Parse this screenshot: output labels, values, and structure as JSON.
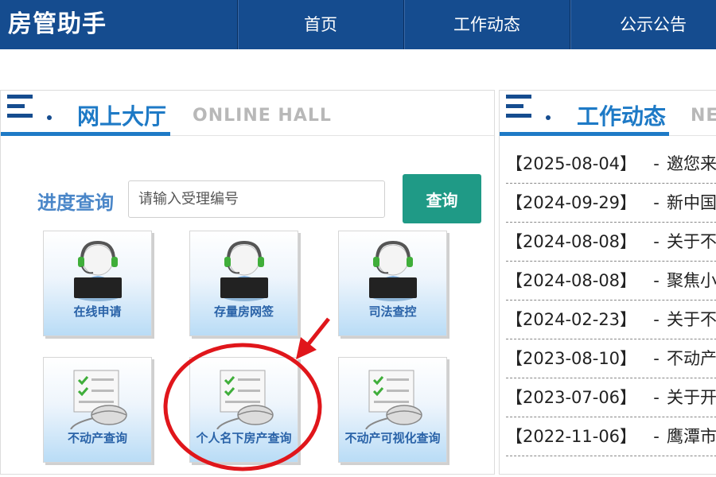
{
  "header": {
    "logo": "房管助手",
    "nav": [
      "首页",
      "工作动态",
      "公示公告"
    ]
  },
  "left_panel": {
    "title": "网上大厅",
    "subtitle": "ONLINE HALL",
    "search": {
      "label": "进度查询",
      "placeholder": "请输入受理编号",
      "button": "查询"
    },
    "tiles": [
      "在线申请",
      "存量房网签",
      "司法查控",
      "不动产查询",
      "个人名下房产查询",
      "不动产可视化查询"
    ]
  },
  "right_panel": {
    "title": "工作动态",
    "subtitle": "NE",
    "news": [
      {
        "date": "【2025-08-04】",
        "dash": "-",
        "title": "邀您来"
      },
      {
        "date": "【2024-09-29】",
        "dash": "-",
        "title": "新中国"
      },
      {
        "date": "【2024-08-08】",
        "dash": "-",
        "title": "关于不"
      },
      {
        "date": "【2024-08-08】",
        "dash": "-",
        "title": "聚焦小"
      },
      {
        "date": "【2024-02-23】",
        "dash": "-",
        "title": "关于不"
      },
      {
        "date": "【2023-08-10】",
        "dash": "-",
        "title": "不动产"
      },
      {
        "date": "【2023-07-06】",
        "dash": "-",
        "title": "关于开"
      },
      {
        "date": "【2022-11-06】",
        "dash": "-",
        "title": "鹰潭市"
      }
    ]
  },
  "colors": {
    "header_bg": "#154c8f",
    "accent_blue": "#1e7ac6",
    "search_button": "#1f9a86",
    "annotation_red": "#e0161b"
  },
  "icons": {
    "menu": "menu-lines-icon",
    "service_agent": "customer-service-agent-icon",
    "document_mouse": "checklist-mouse-icon"
  }
}
